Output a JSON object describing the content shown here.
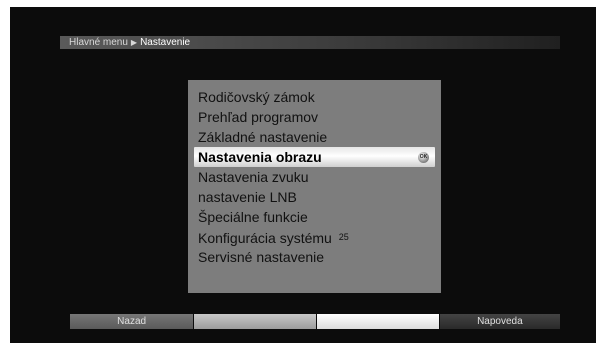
{
  "breadcrumb": {
    "root": "Hlavné menu",
    "current": "Nastavenie"
  },
  "menu": {
    "items": [
      {
        "label": "Rodičovský zámok"
      },
      {
        "label": "Prehľad programov"
      },
      {
        "label": "Základné nastavenie"
      },
      {
        "label": "Nastavenia obrazu",
        "selected": true,
        "badge": "OK"
      },
      {
        "label": "Nastavenia zvuku"
      },
      {
        "label": "nastavenie LNB"
      },
      {
        "label": "Špeciálne funkcie"
      },
      {
        "label": "Konfigurácia systému",
        "suffix": "25"
      },
      {
        "label": "Servisné nastavenie"
      }
    ]
  },
  "bottom_bar": {
    "back_label": "Nazad",
    "help_label": "Napoveda"
  },
  "colors": {
    "screen_bg": "#0c0c0c",
    "panel": "#7d7d7d",
    "highlight": "#ffffff"
  }
}
